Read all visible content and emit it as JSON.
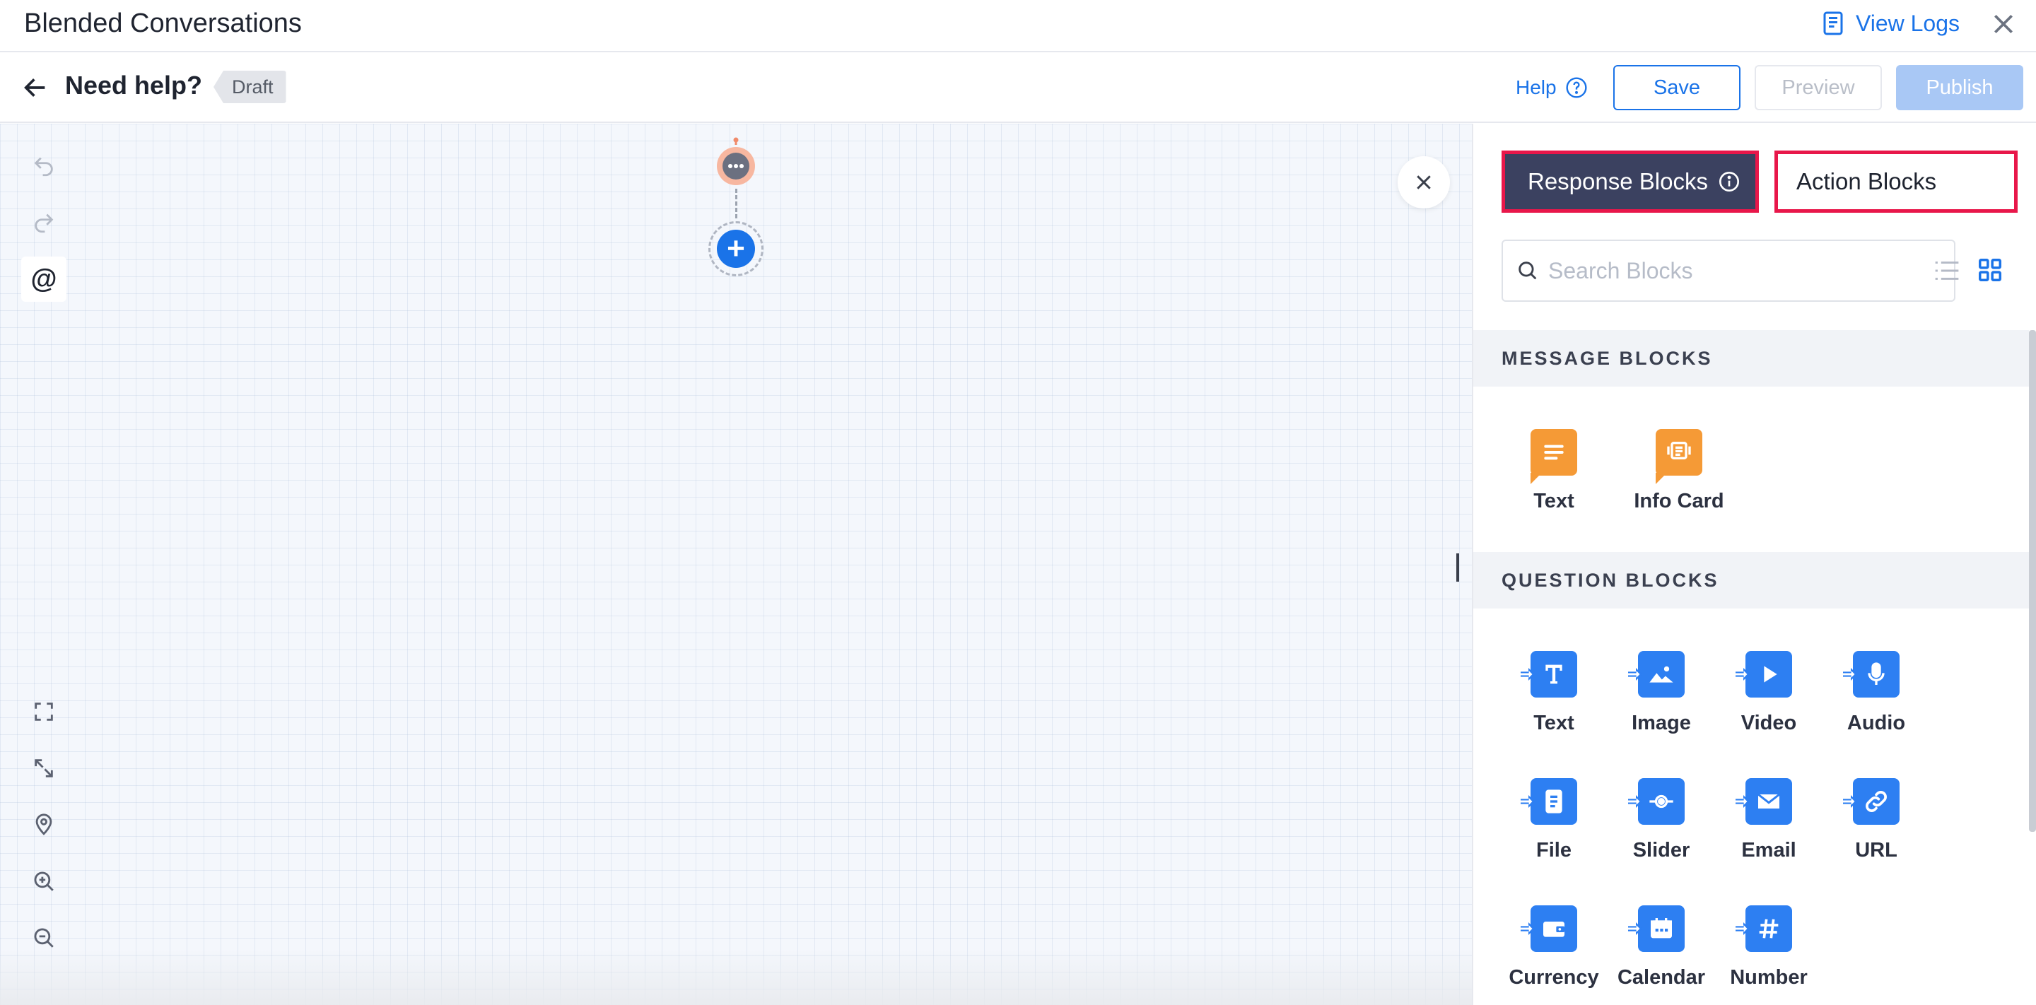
{
  "titlebar": {
    "title": "Blended Conversations",
    "view_logs": "View Logs"
  },
  "header": {
    "flow_name": "Need help?",
    "status": "Draft",
    "help_label": "Help",
    "save_label": "Save",
    "preview_label": "Preview",
    "publish_label": "Publish"
  },
  "panel": {
    "tabs": [
      {
        "label": "Response Blocks",
        "active": true
      },
      {
        "label": "Action Blocks",
        "active": false
      }
    ],
    "search": {
      "placeholder": "Search Blocks",
      "value": ""
    },
    "sections": [
      {
        "title": "MESSAGE BLOCKS",
        "items": [
          {
            "label": "Text",
            "icon": "text-message-icon"
          },
          {
            "label": "Info Card",
            "icon": "info-card-icon"
          }
        ]
      },
      {
        "title": "QUESTION BLOCKS",
        "items": [
          {
            "label": "Text",
            "icon": "text-question-icon"
          },
          {
            "label": "Image",
            "icon": "image-icon"
          },
          {
            "label": "Video",
            "icon": "video-icon"
          },
          {
            "label": "Audio",
            "icon": "microphone-icon"
          },
          {
            "label": "File",
            "icon": "file-icon"
          },
          {
            "label": "Slider",
            "icon": "slider-icon"
          },
          {
            "label": "Email",
            "icon": "email-icon"
          },
          {
            "label": "URL",
            "icon": "link-icon"
          },
          {
            "label": "Currency",
            "icon": "wallet-icon"
          },
          {
            "label": "Calendar",
            "icon": "calendar-icon"
          },
          {
            "label": "Number",
            "icon": "hash-icon"
          }
        ]
      }
    ]
  },
  "canvas": {
    "mention_symbol": "@",
    "add_symbol": "+"
  },
  "colors": {
    "accent": "#1a73e8",
    "tab_active_bg": "#3b4160",
    "highlight_border": "#e8174a",
    "message_block": "#f59a36",
    "question_block": "#2d7ff2"
  }
}
